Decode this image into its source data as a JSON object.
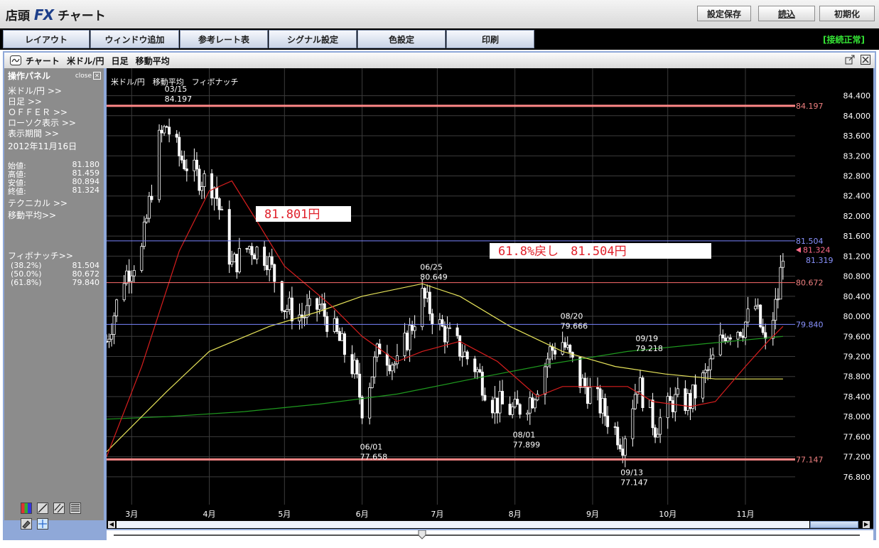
{
  "app": {
    "title_prefix": "店頭",
    "title_fx": "FX",
    "title_suffix": "チャート"
  },
  "toolbar": {
    "save_settings": "設定保存",
    "load": "読込",
    "reset": "初期化"
  },
  "menu": {
    "items": [
      "レイアウト",
      "ウィンドウ追加",
      "参考レート表",
      "シグナル設定",
      "色設定",
      "印刷"
    ],
    "status": "[接続正常]"
  },
  "chart_window": {
    "title": "チャート 米ドル/円 日足 移動平均",
    "subtitle": "米ドル/円　移動平均　フィボナッチ"
  },
  "panel": {
    "title": "操作パネル",
    "close": "close",
    "links": [
      "米ドル/円 >>",
      "日足 >>",
      "ＯＦＦＥＲ >>",
      "ローソク表示 >>",
      "表示期間 >>"
    ],
    "date": "2012年11月16日",
    "ohlc": [
      {
        "label": "始値:",
        "value": "81.180"
      },
      {
        "label": "高値:",
        "value": "81.459"
      },
      {
        "label": "安値:",
        "value": "80.894"
      },
      {
        "label": "終値:",
        "value": "81.324"
      }
    ],
    "technical": "テクニカル >>",
    "moving_avg": "移動平均>>",
    "fibo_title": "フィボナッチ>>",
    "fibo": [
      {
        "label": "(38.2%)",
        "value": "81.504"
      },
      {
        "label": "(50.0%)",
        "value": "80.672"
      },
      {
        "label": "(61.8%)",
        "value": "79.840"
      }
    ]
  },
  "colors": {
    "background": "#000000",
    "grid": "#3c3c3c",
    "bull_candle": "#ffffff",
    "bear_candle": "#ffffff",
    "ma_short": "#d81e1e",
    "ma_mid": "#e6e35a",
    "ma_long": "#1f9a1f",
    "support_resist": "#ff8888",
    "fibo_50": "#ff6b6b",
    "fibo_382_618": "#7a84ff",
    "annotation_text": "#e0202a"
  },
  "chart_data": {
    "type": "candlestick",
    "instrument": "米ドル/円",
    "timeframe": "日足",
    "ylim": [
      76.5,
      84.55
    ],
    "y_ticks": [
      "84.400",
      "84.000",
      "83.600",
      "83.200",
      "82.800",
      "82.400",
      "82.000",
      "81.600",
      "81.200",
      "80.800",
      "80.400",
      "80.000",
      "79.600",
      "79.200",
      "78.800",
      "78.400",
      "78.000",
      "77.600",
      "77.200",
      "76.800"
    ],
    "x_ticks": [
      "3月",
      "4月",
      "5月",
      "6月",
      "7月",
      "8月",
      "9月",
      "10月",
      "11月"
    ],
    "x_range": [
      "2012-02-20",
      "2012-11-20"
    ],
    "closes_series": [
      {
        "date": "2012-02-20",
        "value": 79.5
      },
      {
        "date": "2012-02-27",
        "value": 80.8
      },
      {
        "date": "2012-03-05",
        "value": 81.3
      },
      {
        "date": "2012-03-12",
        "value": 83.5
      },
      {
        "date": "2012-03-15",
        "value": 83.8
      },
      {
        "date": "2012-03-20",
        "value": 83.2
      },
      {
        "date": "2012-03-27",
        "value": 82.8
      },
      {
        "date": "2012-04-03",
        "value": 82.6
      },
      {
        "date": "2012-04-10",
        "value": 81.0
      },
      {
        "date": "2012-04-17",
        "value": 81.4
      },
      {
        "date": "2012-04-24",
        "value": 81.2
      },
      {
        "date": "2012-05-01",
        "value": 80.2
      },
      {
        "date": "2012-05-08",
        "value": 80.0
      },
      {
        "date": "2012-05-15",
        "value": 80.2
      },
      {
        "date": "2012-05-22",
        "value": 79.6
      },
      {
        "date": "2012-05-29",
        "value": 78.9
      },
      {
        "date": "2012-06-01",
        "value": 78.2
      },
      {
        "date": "2012-06-08",
        "value": 79.4
      },
      {
        "date": "2012-06-15",
        "value": 79.0
      },
      {
        "date": "2012-06-25",
        "value": 80.4
      },
      {
        "date": "2012-07-02",
        "value": 79.8
      },
      {
        "date": "2012-07-09",
        "value": 79.4
      },
      {
        "date": "2012-07-16",
        "value": 79.0
      },
      {
        "date": "2012-07-23",
        "value": 78.3
      },
      {
        "date": "2012-08-01",
        "value": 78.1
      },
      {
        "date": "2012-08-08",
        "value": 78.4
      },
      {
        "date": "2012-08-15",
        "value": 79.3
      },
      {
        "date": "2012-08-20",
        "value": 79.5
      },
      {
        "date": "2012-08-27",
        "value": 78.7
      },
      {
        "date": "2012-09-03",
        "value": 78.3
      },
      {
        "date": "2012-09-13",
        "value": 77.5
      },
      {
        "date": "2012-09-19",
        "value": 78.7
      },
      {
        "date": "2012-09-26",
        "value": 77.8
      },
      {
        "date": "2012-10-03",
        "value": 78.3
      },
      {
        "date": "2012-10-10",
        "value": 78.3
      },
      {
        "date": "2012-10-17",
        "value": 78.9
      },
      {
        "date": "2012-10-24",
        "value": 79.7
      },
      {
        "date": "2012-10-31",
        "value": 79.8
      },
      {
        "date": "2012-11-05",
        "value": 80.2
      },
      {
        "date": "2012-11-09",
        "value": 79.4
      },
      {
        "date": "2012-11-14",
        "value": 80.4
      },
      {
        "date": "2012-11-16",
        "value": 81.324
      }
    ],
    "ma_short": [
      {
        "date": "2012-02-20",
        "value": 77.2
      },
      {
        "date": "2012-03-05",
        "value": 79.0
      },
      {
        "date": "2012-03-20",
        "value": 81.3
      },
      {
        "date": "2012-04-01",
        "value": 82.5
      },
      {
        "date": "2012-04-10",
        "value": 82.7
      },
      {
        "date": "2012-04-20",
        "value": 81.9
      },
      {
        "date": "2012-05-01",
        "value": 81.0
      },
      {
        "date": "2012-05-20",
        "value": 80.2
      },
      {
        "date": "2012-06-01",
        "value": 79.6
      },
      {
        "date": "2012-06-15",
        "value": 79.1
      },
      {
        "date": "2012-06-25",
        "value": 79.3
      },
      {
        "date": "2012-07-10",
        "value": 79.5
      },
      {
        "date": "2012-07-25",
        "value": 79.1
      },
      {
        "date": "2012-08-10",
        "value": 78.4
      },
      {
        "date": "2012-08-20",
        "value": 78.6
      },
      {
        "date": "2012-09-01",
        "value": 78.6
      },
      {
        "date": "2012-09-15",
        "value": 78.6
      },
      {
        "date": "2012-09-25",
        "value": 78.3
      },
      {
        "date": "2012-10-10",
        "value": 78.2
      },
      {
        "date": "2012-10-20",
        "value": 78.3
      },
      {
        "date": "2012-11-01",
        "value": 79.0
      },
      {
        "date": "2012-11-10",
        "value": 79.5
      },
      {
        "date": "2012-11-16",
        "value": 79.8
      }
    ],
    "ma_mid": [
      {
        "date": "2012-02-20",
        "value": 77.3
      },
      {
        "date": "2012-03-15",
        "value": 78.5
      },
      {
        "date": "2012-04-01",
        "value": 79.3
      },
      {
        "date": "2012-04-25",
        "value": 79.8
      },
      {
        "date": "2012-05-15",
        "value": 80.1
      },
      {
        "date": "2012-06-01",
        "value": 80.4
      },
      {
        "date": "2012-06-25",
        "value": 80.65
      },
      {
        "date": "2012-07-10",
        "value": 80.4
      },
      {
        "date": "2012-07-30",
        "value": 79.8
      },
      {
        "date": "2012-08-20",
        "value": 79.3
      },
      {
        "date": "2012-09-10",
        "value": 79.0
      },
      {
        "date": "2012-09-30",
        "value": 78.85
      },
      {
        "date": "2012-10-20",
        "value": 78.75
      },
      {
        "date": "2012-11-16",
        "value": 78.75
      }
    ],
    "ma_long": [
      {
        "date": "2012-02-20",
        "value": 77.95
      },
      {
        "date": "2012-03-15",
        "value": 78.0
      },
      {
        "date": "2012-04-15",
        "value": 78.1
      },
      {
        "date": "2012-05-15",
        "value": 78.25
      },
      {
        "date": "2012-06-15",
        "value": 78.45
      },
      {
        "date": "2012-07-15",
        "value": 78.75
      },
      {
        "date": "2012-08-15",
        "value": 79.05
      },
      {
        "date": "2012-09-15",
        "value": 79.3
      },
      {
        "date": "2012-10-15",
        "value": 79.45
      },
      {
        "date": "2012-11-16",
        "value": 79.6
      }
    ],
    "horizontal_lines": [
      {
        "value": 84.197,
        "label": "84.197",
        "kind": "high"
      },
      {
        "value": 77.147,
        "label": "77.147",
        "kind": "low"
      },
      {
        "value": 81.504,
        "label": "81.504",
        "kind": "fibo382"
      },
      {
        "value": 80.672,
        "label": "80.672",
        "kind": "fibo50"
      },
      {
        "value": 79.84,
        "label": "79.840",
        "kind": "fibo618"
      }
    ],
    "price_markers": [
      {
        "value": 81.324,
        "label": "81.324"
      },
      {
        "value": 81.319,
        "label": "81.319"
      }
    ],
    "point_labels": [
      {
        "date": "2012-03-15",
        "value": 84.197,
        "date_label": "03/15",
        "price_label": "84.197",
        "pos": "above"
      },
      {
        "date": "2012-06-01",
        "value": 77.658,
        "date_label": "06/01",
        "price_label": "77.658",
        "pos": "below"
      },
      {
        "date": "2012-06-25",
        "value": 80.649,
        "date_label": "06/25",
        "price_label": "80.649",
        "pos": "above"
      },
      {
        "date": "2012-08-01",
        "value": 77.899,
        "date_label": "08/01",
        "price_label": "77.899",
        "pos": "below"
      },
      {
        "date": "2012-08-20",
        "value": 79.666,
        "date_label": "08/20",
        "price_label": "79.666",
        "pos": "above"
      },
      {
        "date": "2012-09-13",
        "value": 77.147,
        "date_label": "09/13",
        "price_label": "77.147",
        "pos": "below"
      },
      {
        "date": "2012-09-19",
        "value": 79.218,
        "date_label": "09/19",
        "price_label": "79.218",
        "pos": "above"
      }
    ],
    "annotations": [
      {
        "text": "81.801円",
        "anchor_value": 82.1,
        "anchor_date": "2012-03-30"
      },
      {
        "text": "61.8%戻し　81.504円",
        "anchor_value": 81.5,
        "anchor_date": "2012-06-20"
      }
    ]
  }
}
